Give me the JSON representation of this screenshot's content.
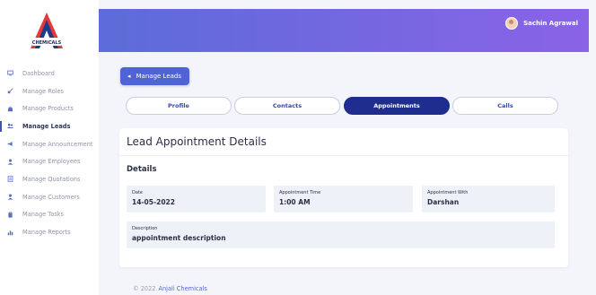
{
  "brand": {
    "logo_text": "CHEMICALS"
  },
  "sidebar": {
    "items": [
      {
        "label": "Dashboard",
        "icon": "monitor-icon"
      },
      {
        "label": "Manage Roles",
        "icon": "key-icon"
      },
      {
        "label": "Manage Products",
        "icon": "bag-icon"
      },
      {
        "label": "Manage Leads",
        "icon": "users-icon",
        "active": true
      },
      {
        "label": "Manage Announcement",
        "icon": "megaphone-icon"
      },
      {
        "label": "Manage Employees",
        "icon": "user-icon"
      },
      {
        "label": "Manage Quotations",
        "icon": "document-icon"
      },
      {
        "label": "Manage Customers",
        "icon": "user-icon"
      },
      {
        "label": "Manage Tasks",
        "icon": "clipboard-icon"
      },
      {
        "label": "Manage Reports",
        "icon": "bar-chart-icon"
      }
    ]
  },
  "header": {
    "user_name": "Sachin Agrawal"
  },
  "back_button": {
    "label": "Manage Leads"
  },
  "tabs": [
    {
      "label": "Profile"
    },
    {
      "label": "Contacts"
    },
    {
      "label": "Appointments",
      "active": true
    },
    {
      "label": "Calls"
    }
  ],
  "card": {
    "title": "Lead Appointment Details",
    "section_title": "Details",
    "fields": {
      "date": {
        "label": "Date",
        "value": "14-05-2022"
      },
      "time": {
        "label": "Appointment Time",
        "value": "1:00 AM"
      },
      "with": {
        "label": "Appointment With",
        "value": "Darshan"
      },
      "description": {
        "label": "Description",
        "value": "appointment description"
      }
    }
  },
  "footer": {
    "copyright": "© 2022",
    "brand": "Anjali Chemicals"
  },
  "colors": {
    "accent": "#4f63d8",
    "active_tab": "#1f2d8f",
    "header_start": "#5c6cd8",
    "header_end": "#8a63e6"
  }
}
